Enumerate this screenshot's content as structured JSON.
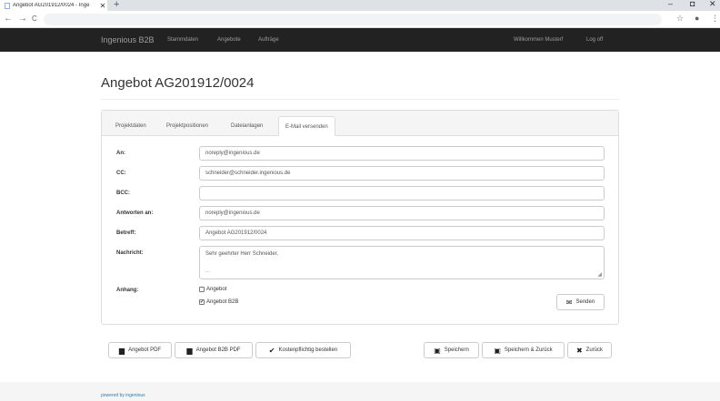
{
  "browser": {
    "tab_title": "Angebot AG201912/0024 - Inge",
    "new_tab": "+",
    "tab_close": "✕",
    "back": "←",
    "forward": "→",
    "reload": "C",
    "star": "☆",
    "profile": "●",
    "menu": "⋮",
    "minimize": "–",
    "restore": "◘",
    "close": "✕"
  },
  "navbar": {
    "brand": "Ingenious B2B",
    "links": [
      "Stammdaten",
      "Angebote",
      "Aufträge"
    ],
    "welcome": "Willkommen Musterf",
    "logout": "Log off"
  },
  "page": {
    "title": "Angebot AG201912/0024"
  },
  "tabs": [
    "Projektdaten",
    "Projektpositionen",
    "Dateianlagen",
    "E-Mail versenden"
  ],
  "form": {
    "to_label": "An:",
    "to_value": "noreply@ingenious.de",
    "cc_label": "CC:",
    "cc_value": "schneider@schneider.ingenious.de",
    "bcc_label": "BCC:",
    "bcc_value": "",
    "reply_label": "Antworten an:",
    "reply_value": "noreply@ingenious.de",
    "subject_label": "Betreff:",
    "subject_value": "Angebot AG201912/0024",
    "message_label": "Nachricht:",
    "message_value": "Sehr geehrter Herr Schneider,",
    "message_more": "...",
    "attach_label": "Anhang:",
    "attach_options": [
      {
        "label": "Angebot",
        "checked": false
      },
      {
        "label": "Angebot B2B",
        "checked": true
      }
    ],
    "send": "Senden"
  },
  "actions": {
    "pdf": "Angebot PDF",
    "b2b_pdf": "Angebot B2B PDF",
    "order": "Kostenpflichtig bestellen",
    "save": "Speichern",
    "save_back": "Speichern & Zurück",
    "back": "Zurück"
  },
  "footer": {
    "link": "powered by ingenious"
  },
  "colors": {
    "navbar_bg": "#222222",
    "link": "#337ab7"
  }
}
